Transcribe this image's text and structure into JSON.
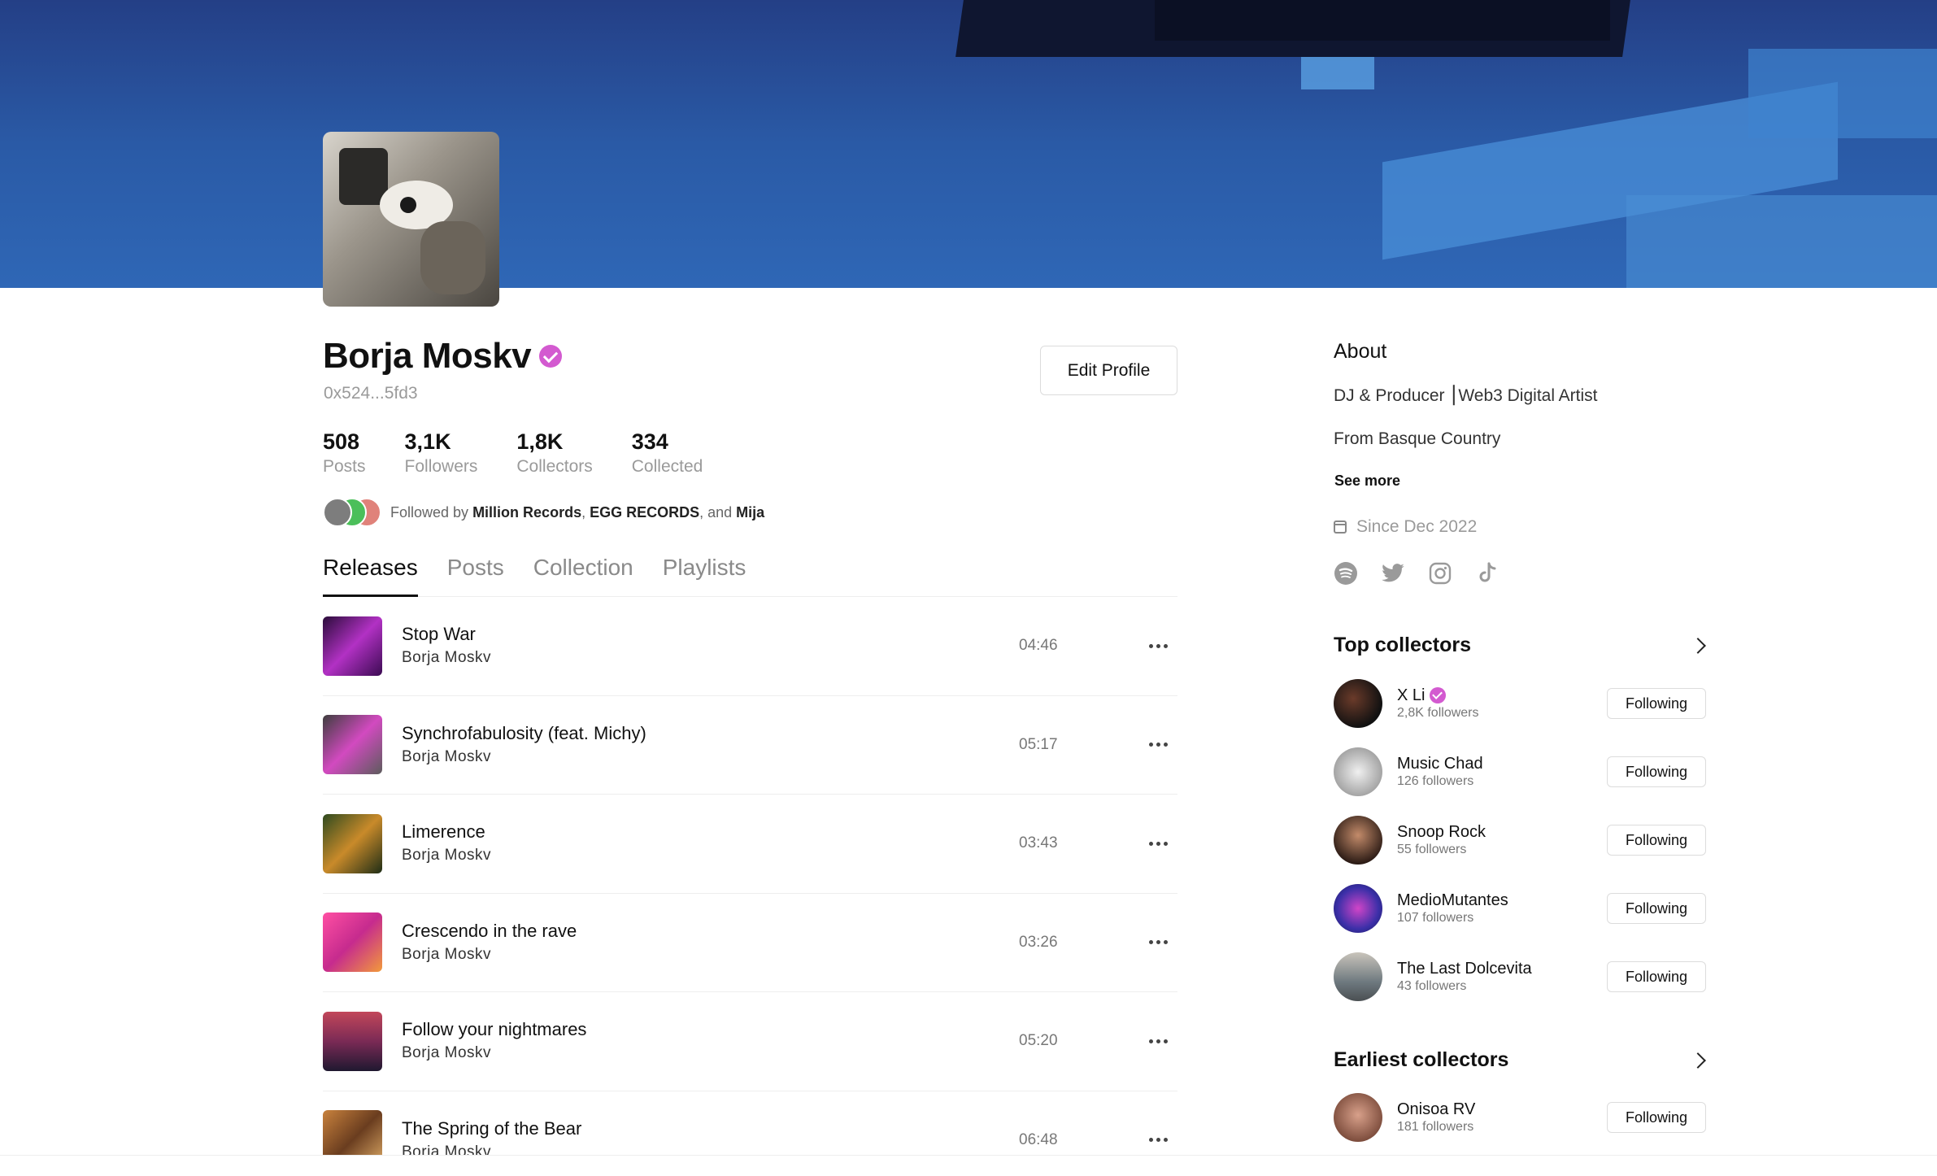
{
  "profile": {
    "name": "Borja Moskv",
    "address": "0x524...5fd3",
    "edit_label": "Edit Profile",
    "verified_color": "#d35ad0"
  },
  "stats": [
    {
      "value": "508",
      "label": "Posts"
    },
    {
      "value": "3,1K",
      "label": "Followers"
    },
    {
      "value": "1,8K",
      "label": "Collectors"
    },
    {
      "value": "334",
      "label": "Collected"
    }
  ],
  "followed_by": {
    "prefix": "Followed by",
    "names": [
      "Million Records",
      "EGG RECORDS",
      "Mija"
    ],
    "sep1": ", ",
    "sep2": ", and "
  },
  "tabs": [
    "Releases",
    "Posts",
    "Collection",
    "Playlists"
  ],
  "active_tab": "Releases",
  "releases": [
    {
      "title": "Stop War",
      "artist": "Borja Moskv",
      "duration": "04:46"
    },
    {
      "title": "Synchrofabulosity (feat. Michy)",
      "artist": "Borja Moskv",
      "duration": "05:17"
    },
    {
      "title": "Limerence",
      "artist": "Borja Moskv",
      "duration": "03:43"
    },
    {
      "title": "Crescendo in the rave",
      "artist": "Borja Moskv",
      "duration": "03:26"
    },
    {
      "title": "Follow your nightmares",
      "artist": "Borja Moskv",
      "duration": "05:20"
    },
    {
      "title": "The Spring of the Bear",
      "artist": "Borja Moskv",
      "duration": "06:48"
    }
  ],
  "about": {
    "heading": "About",
    "line1": "DJ & Producer ⎮Web3 Digital Artist",
    "line2": "From Basque Country",
    "see_more": "See more",
    "since": "Since Dec 2022"
  },
  "socials": [
    "spotify-icon",
    "twitter-icon",
    "instagram-icon",
    "tiktok-icon"
  ],
  "top_collectors": {
    "heading": "Top collectors",
    "items": [
      {
        "name": "X Li",
        "followers": "2,8K followers",
        "verified": true,
        "button": "Following"
      },
      {
        "name": "Music Chad",
        "followers": "126 followers",
        "verified": false,
        "button": "Following"
      },
      {
        "name": "Snoop Rock",
        "followers": "55 followers",
        "verified": false,
        "button": "Following"
      },
      {
        "name": "MedioMutantes",
        "followers": "107 followers",
        "verified": false,
        "button": "Following"
      },
      {
        "name": "The Last Dolcevita",
        "followers": "43 followers",
        "verified": false,
        "button": "Following"
      }
    ]
  },
  "earliest_collectors": {
    "heading": "Earliest collectors",
    "items": [
      {
        "name": "Onisoa RV",
        "followers": "181 followers",
        "button": "Following"
      }
    ]
  }
}
